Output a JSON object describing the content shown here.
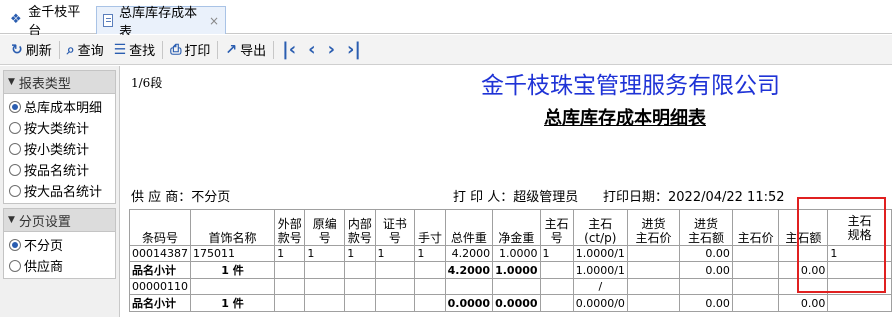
{
  "tabs": {
    "home": "金千枝平台",
    "active": "总库库存成本表",
    "close_glyph": "×"
  },
  "toolbar": {
    "refresh": "刷新",
    "query": "查询",
    "find": "查找",
    "print": "打印",
    "export": "导出"
  },
  "left": {
    "report_type_head": "报表类型",
    "report_types": [
      "总库成本明细",
      "按大类统计",
      "按小类统计",
      "按品名统计",
      "按大品名统计"
    ],
    "paging_head": "分页设置",
    "paging": [
      "不分页",
      "供应商"
    ]
  },
  "report": {
    "segment": "1/6段",
    "company": "金千枝珠宝管理服务有限公司",
    "title": "总库库存成本明细表",
    "supplier": "供 应 商：不分页",
    "printer": "打 印 人：超级管理员",
    "print_date": "打印日期：2022/04/22 11:52",
    "headers": [
      "条码号",
      "首饰名称",
      "外部\n款号",
      "原编号",
      "内部\n款号",
      "证书号",
      "手寸",
      "总件重",
      "净金重",
      "主石\n号",
      "主石\n(ct/p)",
      "进货\n主石价",
      "进货\n主石额",
      "主石价",
      "主石额",
      "主石\n规格"
    ],
    "rows": [
      [
        "00014387",
        "175011",
        "1",
        "1",
        "1",
        "1",
        "1",
        "4.2000",
        "1.0000",
        "1",
        "1.0000/1",
        "",
        "0.00",
        "",
        "",
        "1"
      ],
      [
        "品名小计",
        "1 件",
        "",
        "",
        "",
        "",
        "",
        "4.2000",
        "1.0000",
        "",
        "1.0000/1",
        "",
        "0.00",
        "",
        "0.00",
        ""
      ],
      [
        "00000110",
        "",
        "",
        "",
        "",
        "",
        "",
        "",
        "",
        "",
        "/",
        "",
        "",
        "",
        "",
        ""
      ],
      [
        "品名小计",
        "1 件",
        "",
        "",
        "",
        "",
        "",
        "0.0000",
        "0.0000",
        "",
        "0.0000/0",
        "",
        "0.00",
        "",
        "0.00",
        ""
      ]
    ]
  }
}
